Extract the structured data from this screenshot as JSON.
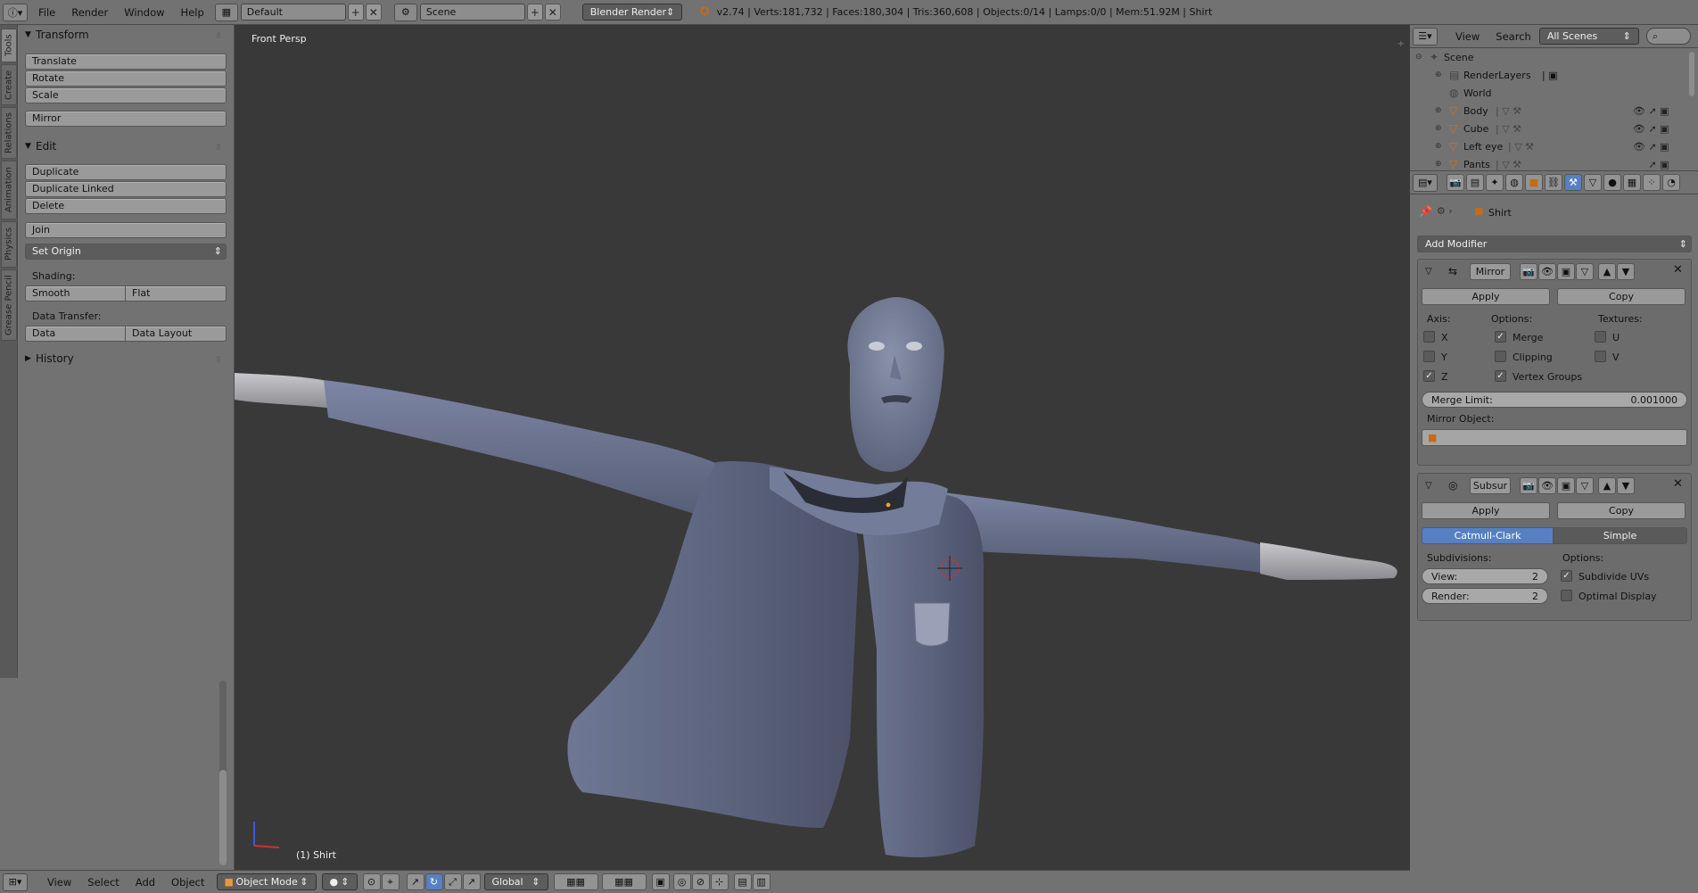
{
  "topbar": {
    "menus": [
      "File",
      "Render",
      "Window",
      "Help"
    ],
    "layout": "Default",
    "scene": "Scene",
    "engine": "Blender Render",
    "stats": "v2.74 | Verts:181,732 | Faces:180,304 | Tris:360,608 | Objects:0/14 | Lamps:0/0 | Mem:51.92M | Shirt"
  },
  "tabs": [
    "Tools",
    "Create",
    "Relations",
    "Animation",
    "Physics",
    "Grease Pencil"
  ],
  "toolshelf": {
    "transform": {
      "title": "Transform",
      "translate": "Translate",
      "rotate": "Rotate",
      "scale": "Scale",
      "mirror": "Mirror"
    },
    "edit": {
      "title": "Edit",
      "duplicate": "Duplicate",
      "duplicate_linked": "Duplicate Linked",
      "delete": "Delete",
      "join": "Join",
      "set_origin": "Set Origin",
      "shading_label": "Shading:",
      "smooth": "Smooth",
      "flat": "Flat",
      "data_transfer_label": "Data Transfer:",
      "data": "Data",
      "data_layout": "Data Layout"
    },
    "history": {
      "title": "History"
    }
  },
  "viewport": {
    "view_label": "Front Persp",
    "object_label": "(1) Shirt"
  },
  "bottombar": {
    "menus": [
      "View",
      "Select",
      "Add",
      "Object"
    ],
    "mode": "Object Mode",
    "orientation": "Global"
  },
  "outliner": {
    "menus": [
      "View",
      "Search"
    ],
    "filter": "All Scenes",
    "rows": [
      {
        "name": "Scene"
      },
      {
        "name": "RenderLayers"
      },
      {
        "name": "World"
      },
      {
        "name": "Body"
      },
      {
        "name": "Cube"
      },
      {
        "name": "Left eye"
      },
      {
        "name": "Pants"
      }
    ]
  },
  "properties": {
    "breadcrumb": "Shirt",
    "add_modifier": "Add Modifier",
    "mirror": {
      "name": "Mirror",
      "apply": "Apply",
      "copy": "Copy",
      "axis_label": "Axis:",
      "options_label": "Options:",
      "textures_label": "Textures:",
      "x": "X",
      "y": "Y",
      "z": "Z",
      "merge": "Merge",
      "clipping": "Clipping",
      "vertex_groups": "Vertex Groups",
      "u": "U",
      "v": "V",
      "merge_limit_label": "Merge Limit:",
      "merge_limit_value": "0.001000",
      "mirror_object_label": "Mirror Object:"
    },
    "subsurf": {
      "name": "Subsur",
      "apply": "Apply",
      "copy": "Copy",
      "catmull": "Catmull-Clark",
      "simple": "Simple",
      "subdivisions_label": "Subdivisions:",
      "options_label": "Options:",
      "view_label": "View:",
      "view_value": "2",
      "render_label": "Render:",
      "render_value": "2",
      "subdivide_uvs": "Subdivide UVs",
      "optimal_display": "Optimal Display"
    }
  },
  "colors": {
    "panel": "#727272",
    "viewport": "#393939",
    "active_blue": "#5680c2",
    "mesh": "#6f7896"
  }
}
